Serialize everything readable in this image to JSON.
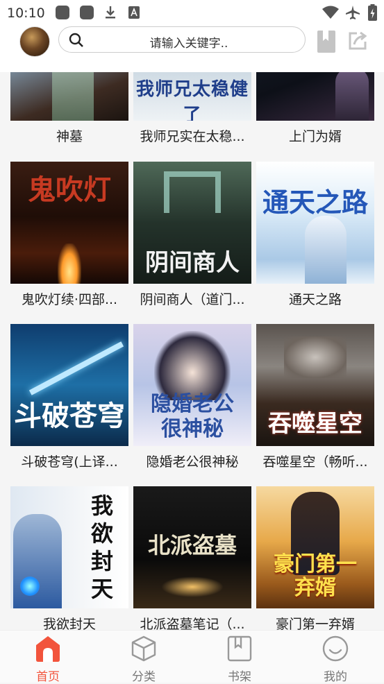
{
  "status_bar": {
    "time": "10:10"
  },
  "header": {
    "search": {
      "placeholder": "请输入关键字.."
    }
  },
  "books": [
    {
      "title": "神墓",
      "cover_text": ""
    },
    {
      "title": "我师兄实在太稳...",
      "cover_text": "我师兄太稳健了"
    },
    {
      "title": "上门为婿",
      "cover_text": ""
    },
    {
      "title": "鬼吹灯续·四部...",
      "cover_text": "鬼吹灯"
    },
    {
      "title": "阴间商人（道门...",
      "cover_text": "阴间商人"
    },
    {
      "title": "通天之路",
      "cover_text": "通天之路"
    },
    {
      "title": "斗破苍穹(上译...",
      "cover_text": "斗破苍穹"
    },
    {
      "title": "隐婚老公很神秘",
      "cover_text": "隐婚老公很神秘"
    },
    {
      "title": "吞噬星空（畅听...",
      "cover_text": "吞噬星空"
    },
    {
      "title": "我欲封天",
      "cover_text": "我欲封天"
    },
    {
      "title": "北派盗墓笔记（...",
      "cover_text": "北派盗墓"
    },
    {
      "title": "豪门第一弃婿",
      "cover_text": "豪门第一弃婿"
    }
  ],
  "bottom_nav": [
    {
      "label": "首页",
      "icon": "home-icon",
      "active": true
    },
    {
      "label": "分类",
      "icon": "cube-icon",
      "active": false
    },
    {
      "label": "书架",
      "icon": "bookshelf-icon",
      "active": false
    },
    {
      "label": "我的",
      "icon": "profile-icon",
      "active": false
    }
  ],
  "colors": {
    "accent": "#f2543c",
    "nav_inactive": "#777777"
  }
}
